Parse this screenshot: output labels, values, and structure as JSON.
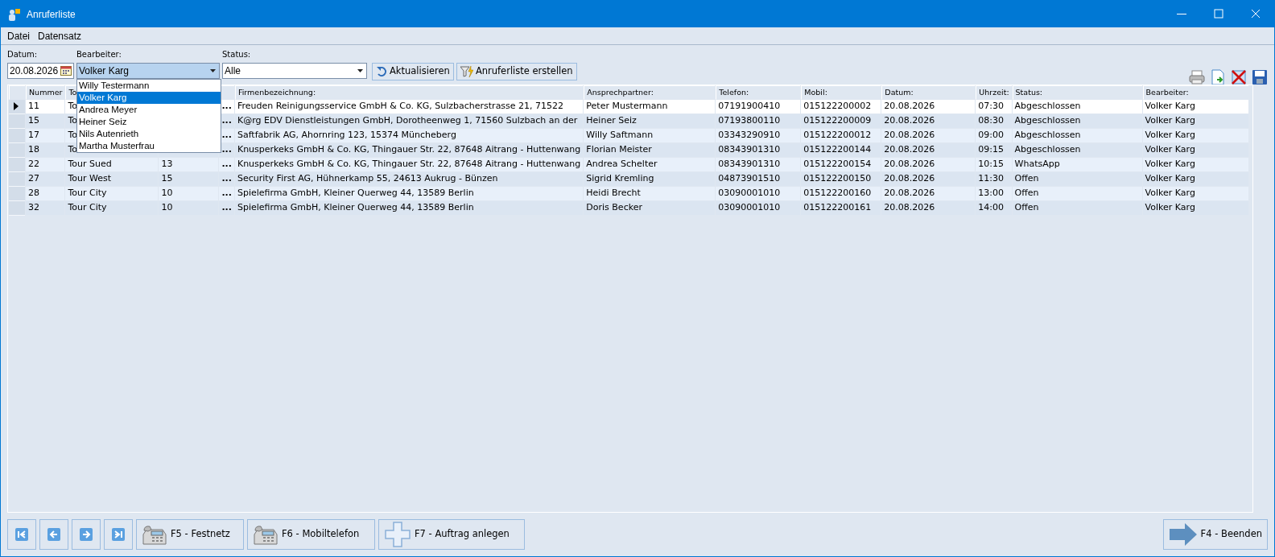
{
  "window": {
    "title": "Anruferliste"
  },
  "menu": [
    {
      "label": "Datei"
    },
    {
      "label": "Datensatz"
    }
  ],
  "filters": {
    "datum": {
      "label": "Datum:",
      "value": "20.08.2026"
    },
    "bearbeiter": {
      "label": "Bearbeiter:",
      "value": "Volker Karg",
      "expanded": true,
      "options": [
        {
          "label": "Willy Testermann",
          "selected": false
        },
        {
          "label": "Volker Karg",
          "selected": true
        },
        {
          "label": "Andrea Meyer",
          "selected": false
        },
        {
          "label": "Heiner Seiz",
          "selected": false
        },
        {
          "label": "Nils Autenrieth",
          "selected": false
        },
        {
          "label": "Martha Musterfrau",
          "selected": false
        }
      ]
    },
    "status": {
      "label": "Status:",
      "value": "Alle"
    }
  },
  "actions": [
    {
      "label": "Aktualisieren",
      "kind": "refresh"
    },
    {
      "label": "Anruferliste erstellen",
      "kind": "create"
    }
  ],
  "toolbar": [
    {
      "kind": "print"
    },
    {
      "kind": "export"
    },
    {
      "kind": "delete"
    },
    {
      "kind": "save"
    }
  ],
  "table": {
    "columns": [
      {
        "label": "Nummer",
        "kind": "text"
      },
      {
        "label": "To",
        "kind": "text"
      },
      {
        "kind": "hidden"
      },
      {
        "kind": "button"
      },
      {
        "label": "Firmenbezeichnung:",
        "kind": "text"
      },
      {
        "label": "Ansprechpartner:",
        "kind": "text"
      },
      {
        "label": "Telefon:",
        "kind": "text"
      },
      {
        "label": "Mobil:",
        "kind": "text"
      },
      {
        "label": "Datum:",
        "kind": "text"
      },
      {
        "label": "Uhrzeit:",
        "kind": "text"
      },
      {
        "label": "Status:",
        "kind": "text"
      },
      {
        "label": "Bearbeiter:",
        "kind": "text"
      }
    ],
    "rows": [
      {
        "current": true,
        "cells": [
          "11",
          "To",
          null,
          "...",
          "Freuden Reinigungsservice GmbH & Co. KG, Sulzbacherstrasse 21, 71522",
          "Peter Mustermann",
          "07191900410",
          "015122200002",
          "20.08.2026",
          "07:30",
          "Abgeschlossen",
          "Volker Karg"
        ]
      },
      {
        "current": false,
        "cells": [
          "15",
          "To",
          null,
          "...",
          "K@rg EDV Dienstleistungen GmbH, Dorotheenweg 1, 71560 Sulzbach an der",
          "Heiner Seiz",
          "07193800110",
          "015122200009",
          "20.08.2026",
          "08:30",
          "Abgeschlossen",
          "Volker Karg"
        ]
      },
      {
        "current": false,
        "cells": [
          "17",
          "To",
          null,
          "...",
          "Saftfabrik AG, Ahornring 123, 15374 Müncheberg",
          "Willy Saftmann",
          "03343290910",
          "015122200012",
          "20.08.2026",
          "09:00",
          "Abgeschlossen",
          "Volker Karg"
        ]
      },
      {
        "current": false,
        "cells": [
          "18",
          "To",
          null,
          "...",
          "Knusperkeks GmbH & Co. KG, Thingauer Str. 22, 87648 Aitrang - Huttenwang",
          "Florian Meister",
          "08343901310",
          "015122200144",
          "20.08.2026",
          "09:15",
          "Abgeschlossen",
          "Volker Karg"
        ]
      },
      {
        "current": false,
        "cells": [
          "22",
          "Tour Sued",
          "13",
          "...",
          "Knusperkeks GmbH & Co. KG, Thingauer Str. 22, 87648 Aitrang - Huttenwang",
          "Andrea Schelter",
          "08343901310",
          "015122200154",
          "20.08.2026",
          "10:15",
          "WhatsApp",
          "Volker Karg"
        ]
      },
      {
        "current": false,
        "cells": [
          "27",
          "Tour West",
          "15",
          "...",
          "Security First AG, Hühnerkamp 55, 24613 Aukrug - Bünzen",
          "Sigrid Kremling",
          "04873901510",
          "015122200150",
          "20.08.2026",
          "11:30",
          "Offen",
          "Volker Karg"
        ]
      },
      {
        "current": false,
        "cells": [
          "28",
          "Tour City",
          "10",
          "...",
          "Spielefirma GmbH, Kleiner Querweg 44, 13589 Berlin",
          "Heidi Brecht",
          "03090001010",
          "015122200160",
          "20.08.2026",
          "13:00",
          "Offen",
          "Volker Karg"
        ]
      },
      {
        "current": false,
        "cells": [
          "32",
          "Tour City",
          "10",
          "...",
          "Spielefirma GmbH, Kleiner Querweg 44, 13589 Berlin",
          "Doris Becker",
          "03090001010",
          "015122200161",
          "20.08.2026",
          "14:00",
          "Offen",
          "Volker Karg"
        ]
      }
    ]
  },
  "nav_buttons": [
    {
      "kind": "first"
    },
    {
      "kind": "prev"
    },
    {
      "kind": "next"
    },
    {
      "kind": "last"
    }
  ],
  "function_buttons": [
    {
      "label": "F5 - Festnetz",
      "kind": "phone"
    },
    {
      "label": "F6 - Mobiltelefon",
      "kind": "phone"
    },
    {
      "label": "F7 - Auftrag anlegen",
      "kind": "plus"
    }
  ],
  "exit_button": {
    "label": "F4 - Beenden",
    "kind": "arrow"
  }
}
